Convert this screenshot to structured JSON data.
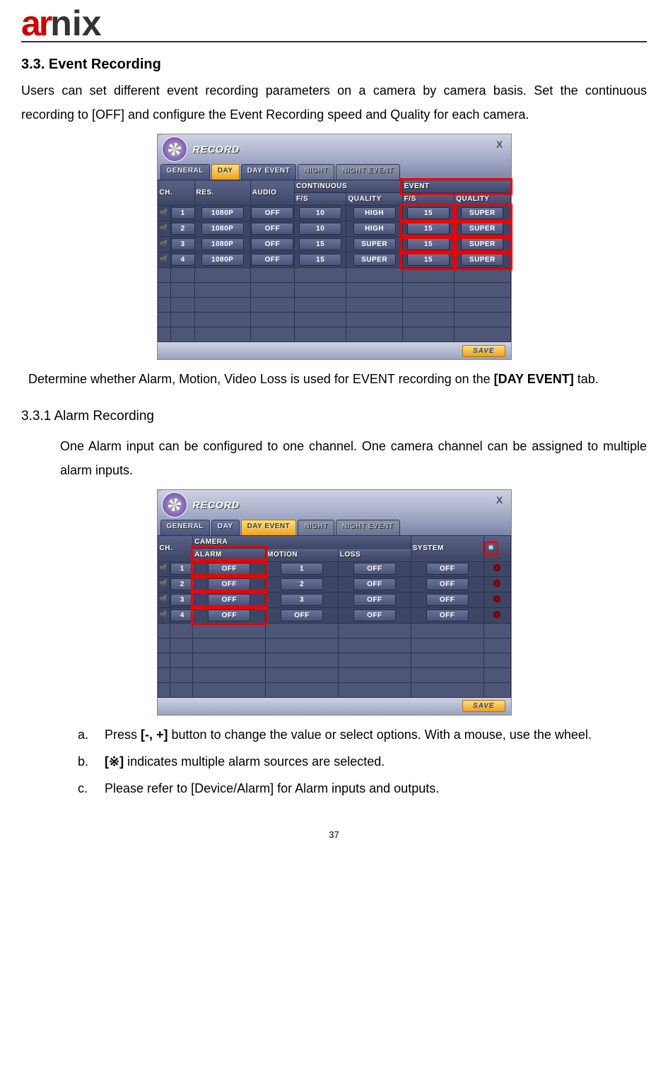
{
  "logo": {
    "a": "a",
    "r": "r",
    "nix": "nix"
  },
  "heading": "3.3.  Event  Recording",
  "intro": "Users can set different event recording parameters on a camera by camera basis. Set the continuous recording to [OFF] and configure the Event Recording speed and Quality for each camera.",
  "note_after_fig1_a": "Determine whether Alarm, Motion, Video Loss is used for EVENT recording on the ",
  "note_after_fig1_bold": "[DAY EVENT]",
  "note_after_fig1_b": " tab.",
  "sub_heading": "3.3.1 Alarm Recording",
  "sub_text": "One Alarm input can be configured to one channel. One camera channel can be assigned to multiple alarm inputs.",
  "list": {
    "a": {
      "lbl": "a.",
      "pre": "Press ",
      "bold": "[-, +]",
      "post": " button to change the value or select options. With a mouse, use the wheel."
    },
    "b": {
      "lbl": "b.",
      "pre": "",
      "bold": "[※]",
      "post": " indicates multiple alarm sources are selected."
    },
    "c": {
      "lbl": "c.",
      "text": "Please refer to [Device/Alarm] for Alarm inputs and outputs."
    }
  },
  "page_number": "37",
  "dvr_common": {
    "title": "RECORD",
    "close": "X",
    "save": "SAVE",
    "tabs": {
      "general": "GENERAL",
      "day": "DAY",
      "day_event": "DAY EVENT",
      "night": "NIGHT",
      "night_event": "NIGHT EVENT"
    }
  },
  "fig1": {
    "headers": {
      "ch": "CH.",
      "res": "RES.",
      "audio": "AUDIO",
      "continuous": "CONTINUOUS",
      "event": "EVENT",
      "fs": "F/S",
      "quality": "QUALITY"
    },
    "rows": [
      {
        "ch": "1",
        "res": "1080P",
        "audio": "OFF",
        "c_fs": "10",
        "c_q": "HIGH",
        "e_fs": "15",
        "e_q": "SUPER"
      },
      {
        "ch": "2",
        "res": "1080P",
        "audio": "OFF",
        "c_fs": "10",
        "c_q": "HIGH",
        "e_fs": "15",
        "e_q": "SUPER"
      },
      {
        "ch": "3",
        "res": "1080P",
        "audio": "OFF",
        "c_fs": "15",
        "c_q": "SUPER",
        "e_fs": "15",
        "e_q": "SUPER"
      },
      {
        "ch": "4",
        "res": "1080P",
        "audio": "OFF",
        "c_fs": "15",
        "c_q": "SUPER",
        "e_fs": "15",
        "e_q": "SUPER"
      }
    ]
  },
  "fig2": {
    "headers": {
      "ch": "CH.",
      "camera": "CAMERA",
      "alarm": "ALARM",
      "motion": "MOTION",
      "loss": "LOSS",
      "system": "SYSTEM",
      "star": "※"
    },
    "rows": [
      {
        "ch": "1",
        "alarm": "OFF",
        "motion": "1",
        "loss": "OFF",
        "system": "OFF"
      },
      {
        "ch": "2",
        "alarm": "OFF",
        "motion": "2",
        "loss": "OFF",
        "system": "OFF"
      },
      {
        "ch": "3",
        "alarm": "OFF",
        "motion": "3",
        "loss": "OFF",
        "system": "OFF"
      },
      {
        "ch": "4",
        "alarm": "OFF",
        "motion": "OFF",
        "loss": "OFF",
        "system": "OFF"
      }
    ]
  }
}
